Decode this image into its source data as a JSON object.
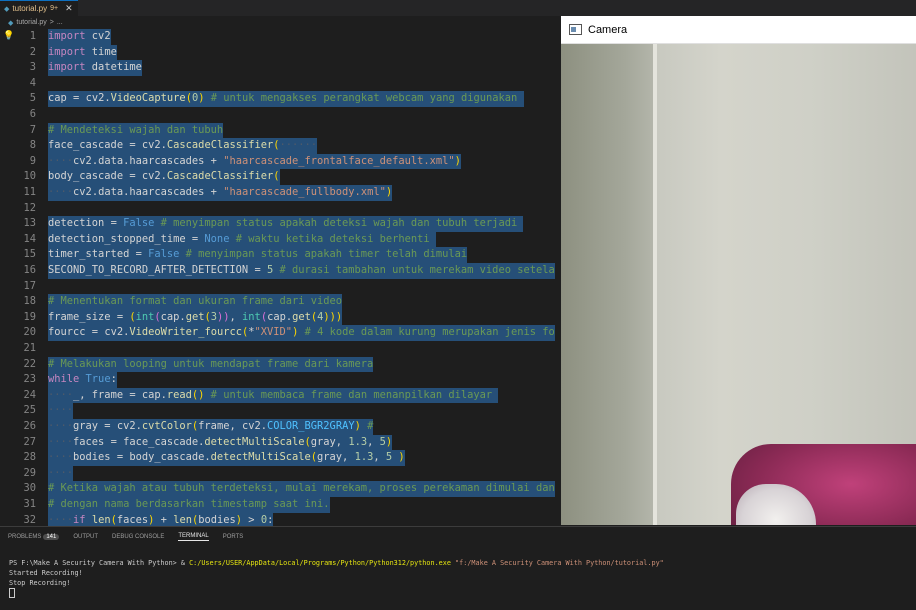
{
  "tab": {
    "filename": "tutorial.py",
    "modified": "9+"
  },
  "breadcrumb": {
    "file": "tutorial.py",
    "sep": ">",
    "more": "..."
  },
  "code_lines": [
    {
      "n": "1",
      "s": [
        {
          "t": "import",
          "c": "kw"
        },
        {
          "t": " cv2",
          "c": "var"
        }
      ]
    },
    {
      "n": "2",
      "s": [
        {
          "t": "import",
          "c": "kw"
        },
        {
          "t": " time",
          "c": "var"
        }
      ]
    },
    {
      "n": "3",
      "s": [
        {
          "t": "import",
          "c": "kw"
        },
        {
          "t": " datetime",
          "c": "var"
        }
      ]
    },
    {
      "n": "4",
      "s": []
    },
    {
      "n": "5",
      "s": [
        {
          "t": "cap",
          "c": "var"
        },
        {
          "t": " = ",
          "c": "var"
        },
        {
          "t": "cv2",
          "c": "var"
        },
        {
          "t": ".",
          "c": "var"
        },
        {
          "t": "VideoCapture",
          "c": "fn"
        },
        {
          "t": "(",
          "c": "br1"
        },
        {
          "t": "0",
          "c": "num"
        },
        {
          "t": ")",
          "c": "br1"
        },
        {
          "t": " # untuk mengakses perangkat webcam yang digunakan ",
          "c": "cm"
        }
      ]
    },
    {
      "n": "6",
      "s": []
    },
    {
      "n": "7",
      "s": [
        {
          "t": "# Mendeteksi wajah dan tubuh",
          "c": "cm"
        }
      ]
    },
    {
      "n": "8",
      "s": [
        {
          "t": "face_cascade",
          "c": "var"
        },
        {
          "t": " = ",
          "c": "var"
        },
        {
          "t": "cv2",
          "c": "var"
        },
        {
          "t": ".",
          "c": "var"
        },
        {
          "t": "CascadeClassifier",
          "c": "fn"
        },
        {
          "t": "(",
          "c": "br1"
        },
        {
          "t": "······",
          "c": "ws"
        }
      ]
    },
    {
      "n": "9",
      "s": [
        {
          "t": "····",
          "c": "ws"
        },
        {
          "t": "cv2",
          "c": "var"
        },
        {
          "t": ".data.haarcascades + ",
          "c": "var"
        },
        {
          "t": "\"haarcascade_frontalface_default.xml\"",
          "c": "str"
        },
        {
          "t": ")",
          "c": "br1"
        }
      ]
    },
    {
      "n": "10",
      "s": [
        {
          "t": "body_cascade",
          "c": "var"
        },
        {
          "t": " = ",
          "c": "var"
        },
        {
          "t": "cv2",
          "c": "var"
        },
        {
          "t": ".",
          "c": "var"
        },
        {
          "t": "CascadeClassifier",
          "c": "fn"
        },
        {
          "t": "(",
          "c": "br1"
        }
      ]
    },
    {
      "n": "11",
      "s": [
        {
          "t": "····",
          "c": "ws"
        },
        {
          "t": "cv2",
          "c": "var"
        },
        {
          "t": ".data.haarcascades + ",
          "c": "var"
        },
        {
          "t": "\"haarcascade_fullbody.xml\"",
          "c": "str"
        },
        {
          "t": ")",
          "c": "br1"
        }
      ]
    },
    {
      "n": "12",
      "s": []
    },
    {
      "n": "13",
      "s": [
        {
          "t": "detection",
          "c": "var"
        },
        {
          "t": " = ",
          "c": "var"
        },
        {
          "t": "False",
          "c": "bool"
        },
        {
          "t": " # menyimpan status apakah deteksi wajah dan tubuh terjadi ",
          "c": "cm"
        }
      ]
    },
    {
      "n": "14",
      "s": [
        {
          "t": "detection_stopped_time",
          "c": "var"
        },
        {
          "t": " = ",
          "c": "var"
        },
        {
          "t": "None",
          "c": "bool"
        },
        {
          "t": " # waktu ketika deteksi berhenti ",
          "c": "cm"
        }
      ]
    },
    {
      "n": "15",
      "s": [
        {
          "t": "timer_started",
          "c": "var"
        },
        {
          "t": " = ",
          "c": "var"
        },
        {
          "t": "False",
          "c": "bool"
        },
        {
          "t": " # menyimpan status apakah timer telah dimulai",
          "c": "cm"
        }
      ]
    },
    {
      "n": "16",
      "s": [
        {
          "t": "SECOND_TO_RECORD_AFTER_DETECTION",
          "c": "var"
        },
        {
          "t": " = ",
          "c": "var"
        },
        {
          "t": "5",
          "c": "num"
        },
        {
          "t": " # durasi tambahan untuk merekam video setela",
          "c": "cm"
        }
      ]
    },
    {
      "n": "17",
      "s": []
    },
    {
      "n": "18",
      "s": [
        {
          "t": "# Menentukan format dan ukuran frame dari video",
          "c": "cm"
        }
      ]
    },
    {
      "n": "19",
      "s": [
        {
          "t": "frame_size",
          "c": "var"
        },
        {
          "t": " = ",
          "c": "var"
        },
        {
          "t": "(",
          "c": "br1"
        },
        {
          "t": "int",
          "c": "cl"
        },
        {
          "t": "(",
          "c": "br2"
        },
        {
          "t": "cap.",
          "c": "var"
        },
        {
          "t": "get",
          "c": "fn"
        },
        {
          "t": "(",
          "c": "br1"
        },
        {
          "t": "3",
          "c": "num"
        },
        {
          "t": "))",
          "c": "br2"
        },
        {
          "t": ", ",
          "c": "var"
        },
        {
          "t": "int",
          "c": "cl"
        },
        {
          "t": "(",
          "c": "br2"
        },
        {
          "t": "cap.",
          "c": "var"
        },
        {
          "t": "get",
          "c": "fn"
        },
        {
          "t": "(",
          "c": "br1"
        },
        {
          "t": "4",
          "c": "num"
        },
        {
          "t": ")))",
          "c": "br1"
        }
      ]
    },
    {
      "n": "20",
      "s": [
        {
          "t": "fourcc",
          "c": "var"
        },
        {
          "t": " = ",
          "c": "var"
        },
        {
          "t": "cv2",
          "c": "var"
        },
        {
          "t": ".",
          "c": "var"
        },
        {
          "t": "VideoWriter_fourcc",
          "c": "fn"
        },
        {
          "t": "(",
          "c": "br1"
        },
        {
          "t": "*",
          "c": "var"
        },
        {
          "t": "\"XVID\"",
          "c": "str"
        },
        {
          "t": ")",
          "c": "br1"
        },
        {
          "t": " # 4 kode dalam kurung merupakan jenis fo",
          "c": "cm"
        }
      ]
    },
    {
      "n": "21",
      "s": []
    },
    {
      "n": "22",
      "s": [
        {
          "t": "# Melakukan looping untuk mendapat frame dari kamera",
          "c": "cm"
        }
      ]
    },
    {
      "n": "23",
      "s": [
        {
          "t": "while",
          "c": "kw"
        },
        {
          "t": " ",
          "c": "var"
        },
        {
          "t": "True",
          "c": "bool"
        },
        {
          "t": ":",
          "c": "var"
        }
      ]
    },
    {
      "n": "24",
      "s": [
        {
          "t": "····",
          "c": "ws"
        },
        {
          "t": "_, frame = cap.",
          "c": "var"
        },
        {
          "t": "read",
          "c": "fn"
        },
        {
          "t": "()",
          "c": "br1"
        },
        {
          "t": " # untuk membaca frame dan menanpilkan dilayar ",
          "c": "cm"
        }
      ]
    },
    {
      "n": "25",
      "s": [
        {
          "t": "····",
          "c": "ws"
        }
      ]
    },
    {
      "n": "26",
      "s": [
        {
          "t": "····",
          "c": "ws"
        },
        {
          "t": "gray = cv2.",
          "c": "var"
        },
        {
          "t": "cvtColor",
          "c": "fn"
        },
        {
          "t": "(",
          "c": "br1"
        },
        {
          "t": "frame, cv2.",
          "c": "var"
        },
        {
          "t": "COLOR_BGR2GRAY",
          "c": "cst"
        },
        {
          "t": ")",
          "c": "br1"
        },
        {
          "t": " #",
          "c": "cm"
        }
      ]
    },
    {
      "n": "27",
      "s": [
        {
          "t": "····",
          "c": "ws"
        },
        {
          "t": "faces = face_cascade.",
          "c": "var"
        },
        {
          "t": "detectMultiScale",
          "c": "fn"
        },
        {
          "t": "(",
          "c": "br1"
        },
        {
          "t": "gray, ",
          "c": "var"
        },
        {
          "t": "1.3",
          "c": "num"
        },
        {
          "t": ", ",
          "c": "var"
        },
        {
          "t": "5",
          "c": "num"
        },
        {
          "t": ")",
          "c": "br1"
        }
      ]
    },
    {
      "n": "28",
      "s": [
        {
          "t": "····",
          "c": "ws"
        },
        {
          "t": "bodies = body_cascade.",
          "c": "var"
        },
        {
          "t": "detectMultiScale",
          "c": "fn"
        },
        {
          "t": "(",
          "c": "br1"
        },
        {
          "t": "gray, ",
          "c": "var"
        },
        {
          "t": "1.3",
          "c": "num"
        },
        {
          "t": ", ",
          "c": "var"
        },
        {
          "t": "5",
          "c": "num"
        },
        {
          "t": " )",
          "c": "br1"
        }
      ]
    },
    {
      "n": "29",
      "s": [
        {
          "t": "····",
          "c": "ws"
        }
      ]
    },
    {
      "n": "30",
      "s": [
        {
          "t": "# Ketika wajah atau tubuh terdeteksi, mulai merekam, proses perekaman dimulai dan",
          "c": "cm"
        }
      ]
    },
    {
      "n": "31",
      "s": [
        {
          "t": "# dengan nama berdasarkan timestamp saat ini.",
          "c": "cm"
        }
      ]
    },
    {
      "n": "32",
      "s": [
        {
          "t": "····",
          "c": "ws"
        },
        {
          "t": "if",
          "c": "kw"
        },
        {
          "t": " ",
          "c": "var"
        },
        {
          "t": "len",
          "c": "fn"
        },
        {
          "t": "(",
          "c": "br1"
        },
        {
          "t": "faces",
          "c": "var"
        },
        {
          "t": ")",
          "c": "br1"
        },
        {
          "t": " + ",
          "c": "var"
        },
        {
          "t": "len",
          "c": "fn"
        },
        {
          "t": "(",
          "c": "br1"
        },
        {
          "t": "bodies",
          "c": "var"
        },
        {
          "t": ")",
          "c": "br1"
        },
        {
          "t": " > ",
          "c": "var"
        },
        {
          "t": "0",
          "c": "num"
        },
        {
          "t": ":",
          "c": "var"
        }
      ]
    }
  ],
  "camera_window": {
    "title": "Camera"
  },
  "panel": {
    "tabs": [
      {
        "label": "PROBLEMS",
        "badge": "141"
      },
      {
        "label": "OUTPUT"
      },
      {
        "label": "DEBUG CONSOLE"
      },
      {
        "label": "TERMINAL"
      },
      {
        "label": "PORTS"
      }
    ],
    "active_tab": "TERMINAL",
    "terminal": {
      "prompt": "PS F:\\Make A Security Camera With Python> & ",
      "exe": "C:/Users/USER/AppData/Local/Programs/Python/Python312/python.exe",
      "arg": " \"f:/Make A Security Camera With Python/tutorial.py\"",
      "output": [
        "Started Recording!",
        "Stop Recording!"
      ]
    }
  },
  "colors": {
    "accent": "#0e70c0",
    "editor_bg": "#1e1e1e",
    "selection": "#264f78",
    "lightbulb": "#ffcc00"
  }
}
